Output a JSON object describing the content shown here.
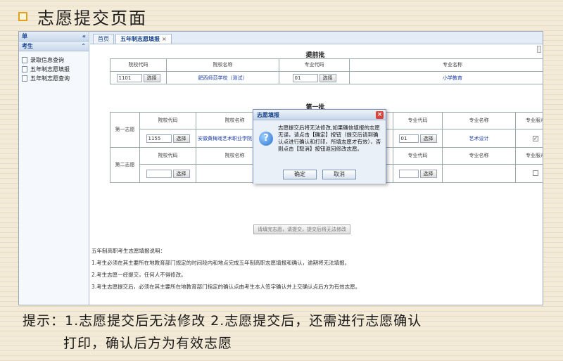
{
  "slide": {
    "title": "志愿提交页面",
    "tip_line1": "提示：1.志愿提交后无法修改 2.志愿提交后，还需进行志愿确认",
    "tip_line2": "打印，确认后方为有效志愿"
  },
  "left_panel": {
    "header": "单",
    "section": "考生",
    "items": [
      "录取信息查询",
      "五年制志愿填报",
      "五年制志愿查询"
    ]
  },
  "tabs": [
    {
      "label": "首页"
    },
    {
      "label": "五年制志愿填报",
      "close": "×"
    }
  ],
  "batch_pre": {
    "title": "提前批",
    "labels": {
      "school_code": "院校代码",
      "school_name": "院校名称",
      "major_code": "专业代码",
      "major_name": "专业名称"
    },
    "school_code": "1101",
    "select": "选择",
    "school_name": "肥西师范学校（测试）",
    "major_code": "01",
    "major_name": "小学教育"
  },
  "batch_1": {
    "title": "第一批",
    "first_choice": "第一志愿",
    "second_choice": "第二志愿",
    "obey_label": "专业服从",
    "school_code": "1155",
    "school_name": "安徽黄梅戏艺术职业学院（测试）",
    "major_code": "01",
    "major_name": "艺术设计",
    "obey_checked": "✓"
  },
  "submit_button": "请填完志愿，请提交，提交后将无法修改",
  "notes": [
    "五年制高职考生志愿填报说明：",
    "1.考生必须在其主要所在地教育部门规定的时间段内和地点完成五年制高职志愿填报和确认，逾期将无法填报。",
    "2.考生志愿一经提交，任何人不得修改。",
    "3.考生志愿提交后，必须在其主要所在地教育部门指定的确认点由考生本人签字确认并上交确认点后方为有效志愿。"
  ],
  "dialog": {
    "title": "志愿填报",
    "close": "×",
    "message": "志愿提交后将无法修改,如果确信填报的志愿无误，请点击【确定】按钮（提交后请到确认点进行确认和打印，所填志愿才有效），否则点击【取消】按钮返回修改志愿。",
    "ok": "确定",
    "cancel": "取消"
  }
}
